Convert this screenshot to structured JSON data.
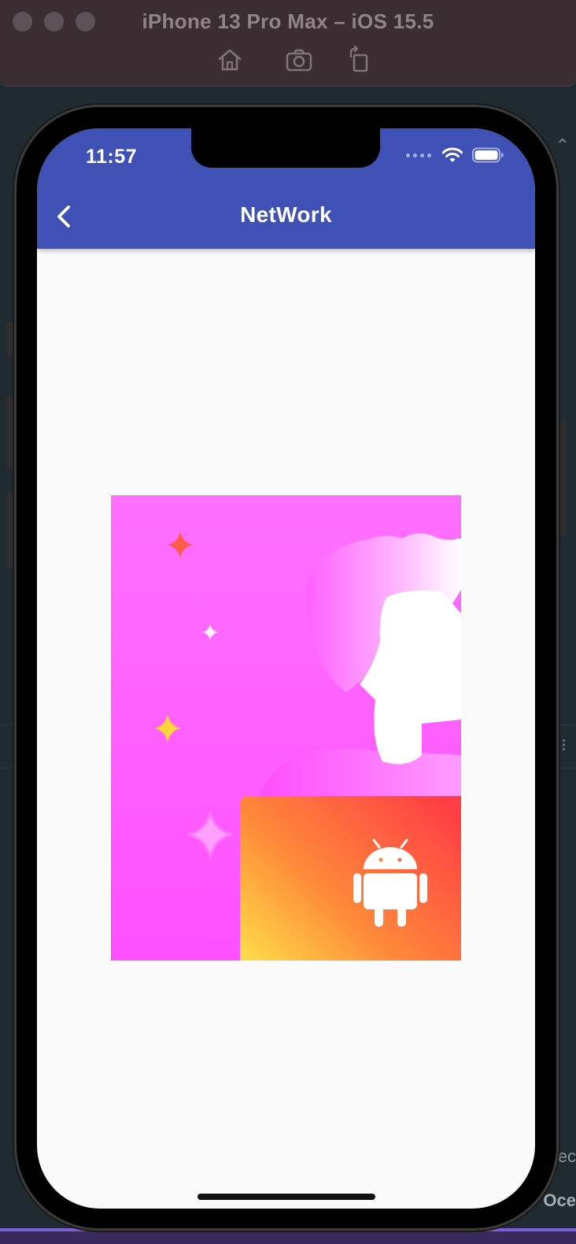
{
  "simulator": {
    "title": "iPhone 13 Pro Max – iOS 15.5",
    "toolbar": [
      "home-icon",
      "screenshot-icon",
      "rotate-icon"
    ]
  },
  "background_ide": {
    "fragment_1": "ec",
    "fragment_2": "Oce"
  },
  "status_bar": {
    "time": "11:57",
    "icons": [
      "cellular-dots-icon",
      "wifi-icon",
      "battery-icon"
    ]
  },
  "app_bar": {
    "title": "NetWork",
    "back_icon": "chevron-left-icon",
    "color": "#3f51b5"
  },
  "content": {
    "image": {
      "description_icon": "android-icon",
      "background": "#ff5cff"
    }
  },
  "colors": {
    "screen_background": "#fafafa",
    "accent": "#3f51b5"
  }
}
